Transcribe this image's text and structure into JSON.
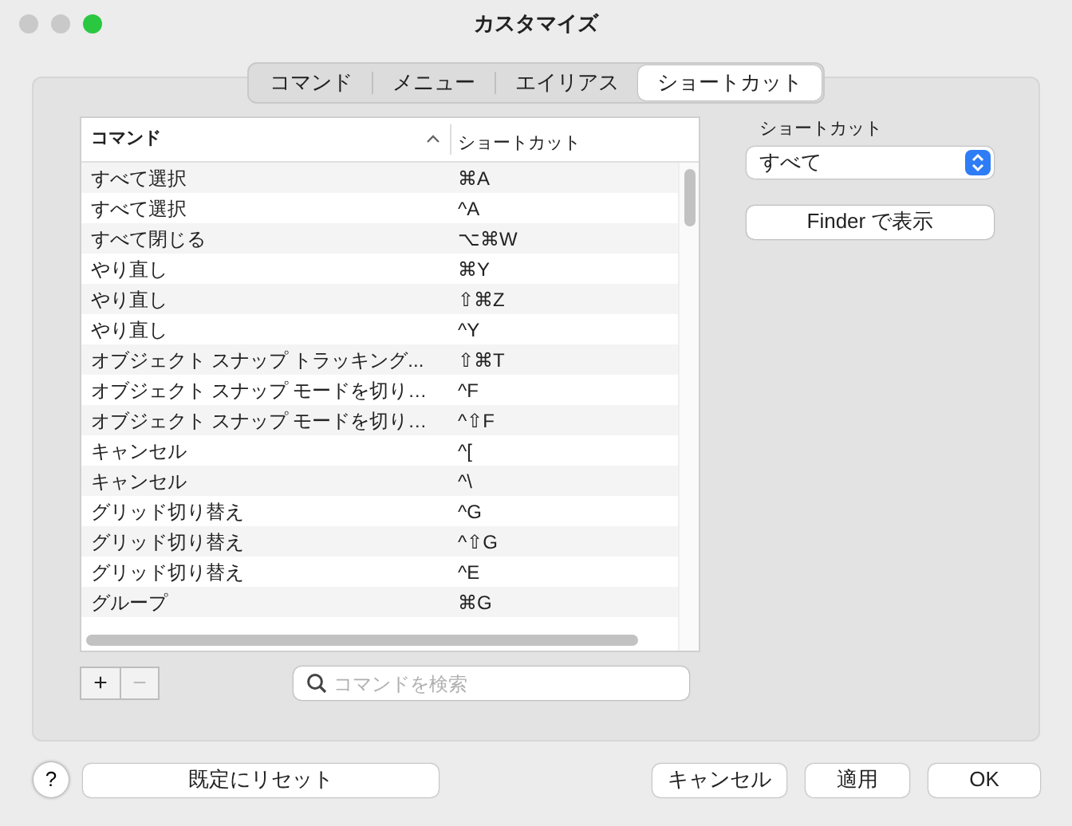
{
  "window": {
    "title": "カスタマイズ"
  },
  "tabs": [
    {
      "label": "コマンド",
      "selected": false
    },
    {
      "label": "メニュー",
      "selected": false
    },
    {
      "label": "エイリアス",
      "selected": false
    },
    {
      "label": "ショートカット",
      "selected": true
    }
  ],
  "table": {
    "columns": [
      {
        "label": "コマンド",
        "sorted": true
      },
      {
        "label": "ショートカット",
        "sorted": false
      }
    ],
    "rows": [
      [
        "すべて選択",
        "⌘A"
      ],
      [
        "すべて選択",
        "^A"
      ],
      [
        "すべて閉じる",
        "⌥⌘W"
      ],
      [
        "やり直し",
        "⌘Y"
      ],
      [
        "やり直し",
        "⇧⌘Z"
      ],
      [
        "やり直し",
        "^Y"
      ],
      [
        "オブジェクト スナップ トラッキング...",
        "⇧⌘T"
      ],
      [
        "オブジェクト スナップ モードを切り…",
        "^F"
      ],
      [
        "オブジェクト スナップ モードを切り…",
        "^⇧F"
      ],
      [
        "キャンセル",
        "^["
      ],
      [
        "キャンセル",
        "^\\"
      ],
      [
        "グリッド切り替え",
        "^G"
      ],
      [
        "グリッド切り替え",
        "^⇧G"
      ],
      [
        "グリッド切り替え",
        "^E"
      ],
      [
        "グループ",
        "⌘G"
      ]
    ]
  },
  "add_button": {
    "label": "+",
    "disabled": false
  },
  "remove_button": {
    "label": "−",
    "disabled": true
  },
  "search": {
    "placeholder": "コマンドを検索"
  },
  "filter": {
    "label": "ショートカット",
    "value": "すべて"
  },
  "finder_button": "Finder で表示",
  "help_button": "?",
  "reset_button": "既定にリセット",
  "buttons": [
    "キャンセル",
    "適用",
    "OK"
  ]
}
